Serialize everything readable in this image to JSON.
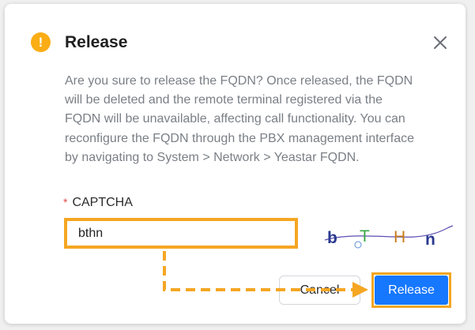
{
  "dialog": {
    "title": "Release",
    "message": "Are you sure to release the FQDN? Once released, the FQDN will be deleted and the remote terminal registered via the FQDN will be unavailable, affecting call functionality. You can reconfigure the FQDN through the PBX management interface by navigating to System > Network > Yeastar FQDN.",
    "message_lines": [
      "Are you sure to release the FQDN? Once released, the FQDN",
      "will be deleted and the remote terminal registered via the",
      "FQDN will be unavailable, affecting call functionality. You can",
      "reconfigure the FQDN through the PBX management interface",
      "by navigating to System > Network > Yeastar FQDN."
    ]
  },
  "captcha": {
    "required_mark": "*",
    "label": "CAPTCHA",
    "input_value": "bthn",
    "image_chars": [
      {
        "char": "b",
        "color": "#2b3a8f"
      },
      {
        "char": "T",
        "color": "#3aa845"
      },
      {
        "char": "H",
        "color": "#c77a18"
      },
      {
        "char": "n",
        "color": "#2b3a8f"
      }
    ]
  },
  "buttons": {
    "cancel_label": "Cancel",
    "release_label": "Release"
  },
  "icons": {
    "warning": "exclamation-circle-icon",
    "close": "close-icon"
  },
  "colors": {
    "warning": "#faad14",
    "primary": "#1677ff",
    "highlight": "#f5a623",
    "required": "#e54848"
  }
}
